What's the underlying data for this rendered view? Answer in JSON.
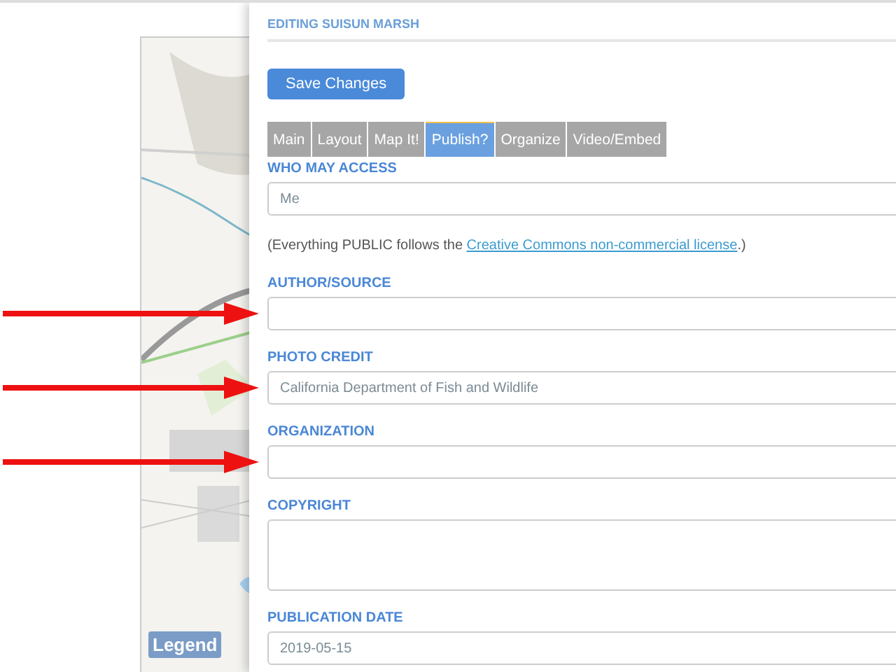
{
  "map": {
    "kind": "picture",
    "legend_button": "Legend"
  },
  "editor": {
    "title": "EDITING SUISUN MARSH",
    "save_button": "Save Changes",
    "tabs": [
      {
        "label": "Main",
        "selected": false
      },
      {
        "label": "Layout",
        "selected": false
      },
      {
        "label": "Map It!",
        "selected": false
      },
      {
        "label": "Publish?",
        "selected": true
      },
      {
        "label": "Organize",
        "selected": false
      },
      {
        "label": "Video/Embed",
        "selected": false
      }
    ],
    "access": {
      "label": "WHO MAY ACCESS",
      "value": "Me"
    },
    "notice": {
      "before": "(Everything PUBLIC follows the ",
      "link": "Creative Commons non-commercial license",
      "after": ".)"
    },
    "fields": [
      {
        "label": "AUTHOR/SOURCE",
        "kind": "input",
        "arrow": true
      },
      {
        "label": "PHOTO CREDIT",
        "kind": "input",
        "value": "California Department of Fish and Wildlife",
        "arrow": true
      },
      {
        "label": "ORGANIZATION",
        "kind": "input",
        "arrow": true
      },
      {
        "label": "COPYRIGHT",
        "kind": "textarea",
        "arrow": false
      },
      {
        "label": "PUBLICATION DATE",
        "kind": "input",
        "value": "2019-05-15",
        "arrow": false
      }
    ]
  }
}
